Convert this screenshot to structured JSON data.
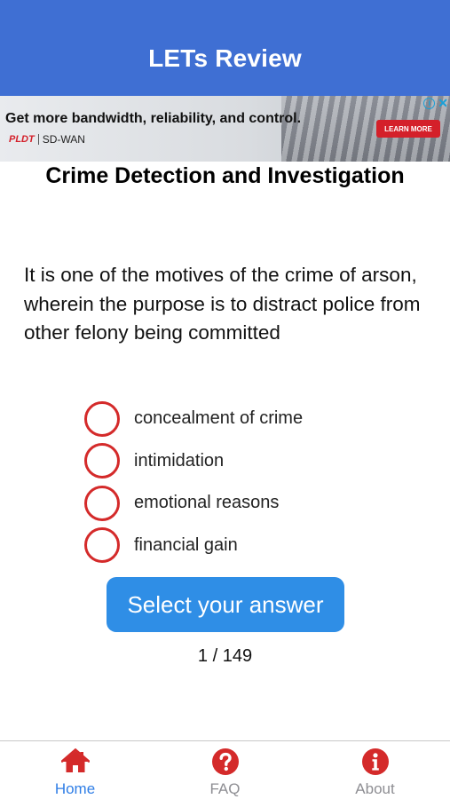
{
  "header": {
    "title": "LETs Review"
  },
  "ad": {
    "headline": "Get more bandwidth, reliability, and control.",
    "logo": "PLDT",
    "product": "SD-WAN",
    "cta": "LEARN MORE"
  },
  "quiz": {
    "category": "Crime Detection and Investigation",
    "question": "It is one of the motives of the crime of arson, wherein the purpose is to distract police from other felony being committed",
    "options": [
      {
        "label": "concealment of crime"
      },
      {
        "label": "intimidation"
      },
      {
        "label": "emotional reasons"
      },
      {
        "label": "financial gain"
      }
    ],
    "submit_label": "Select your answer",
    "progress": "1 / 149"
  },
  "tabs": [
    {
      "label": "Home",
      "icon": "home-icon",
      "active": true
    },
    {
      "label": "FAQ",
      "icon": "question-circle-icon",
      "active": false
    },
    {
      "label": "About",
      "icon": "info-circle-icon",
      "active": false
    }
  ],
  "colors": {
    "header_bg": "#3f6fd3",
    "button_bg": "#2f8ee6",
    "radio_border": "#d42a2a",
    "tab_icon": "#d42a2a",
    "tab_active_label": "#2f7ee6",
    "tab_inactive_label": "#8e8e93"
  }
}
